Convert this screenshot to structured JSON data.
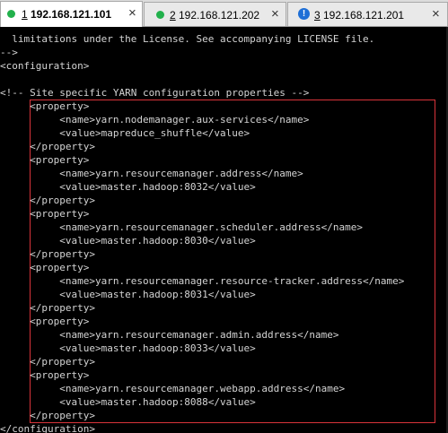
{
  "tabs": [
    {
      "num": "1",
      "host": "192.168.121.101",
      "status": "connected",
      "close": "×"
    },
    {
      "num": "2",
      "host": "192.168.121.202",
      "status": "connected",
      "close": "×"
    },
    {
      "num": "3",
      "host": "192.168.121.201",
      "status": "warning",
      "status_glyph": "!",
      "close": "×"
    }
  ],
  "colors": {
    "terminal_bg": "#000000",
    "terminal_fg": "#d4d4d4",
    "highlight_border": "#d9343a",
    "connected": "#22b14c",
    "warning": "#1f6fd6"
  },
  "terminal": {
    "lines": [
      "  limitations under the License. See accompanying LICENSE file.",
      "-->",
      "<configuration>",
      "",
      "<!-- Site specific YARN configuration properties -->",
      "     <property>",
      "          <name>yarn.nodemanager.aux-services</name>",
      "          <value>mapreduce_shuffle</value>",
      "     </property>",
      "     <property>",
      "          <name>yarn.resourcemanager.address</name>",
      "          <value>master.hadoop:8032</value>",
      "     </property>",
      "     <property>",
      "          <name>yarn.resourcemanager.scheduler.address</name>",
      "          <value>master.hadoop:8030</value>",
      "     </property>",
      "     <property>",
      "          <name>yarn.resourcemanager.resource-tracker.address</name>",
      "          <value>master.hadoop:8031</value>",
      "     </property>",
      "     <property>",
      "          <name>yarn.resourcemanager.admin.address</name>",
      "          <value>master.hadoop:8033</value>",
      "     </property>",
      "     <property>",
      "          <name>yarn.resourcemanager.webapp.address</name>",
      "          <value>master.hadoop:8088</value>",
      "     </property>",
      "</configuration>"
    ]
  }
}
